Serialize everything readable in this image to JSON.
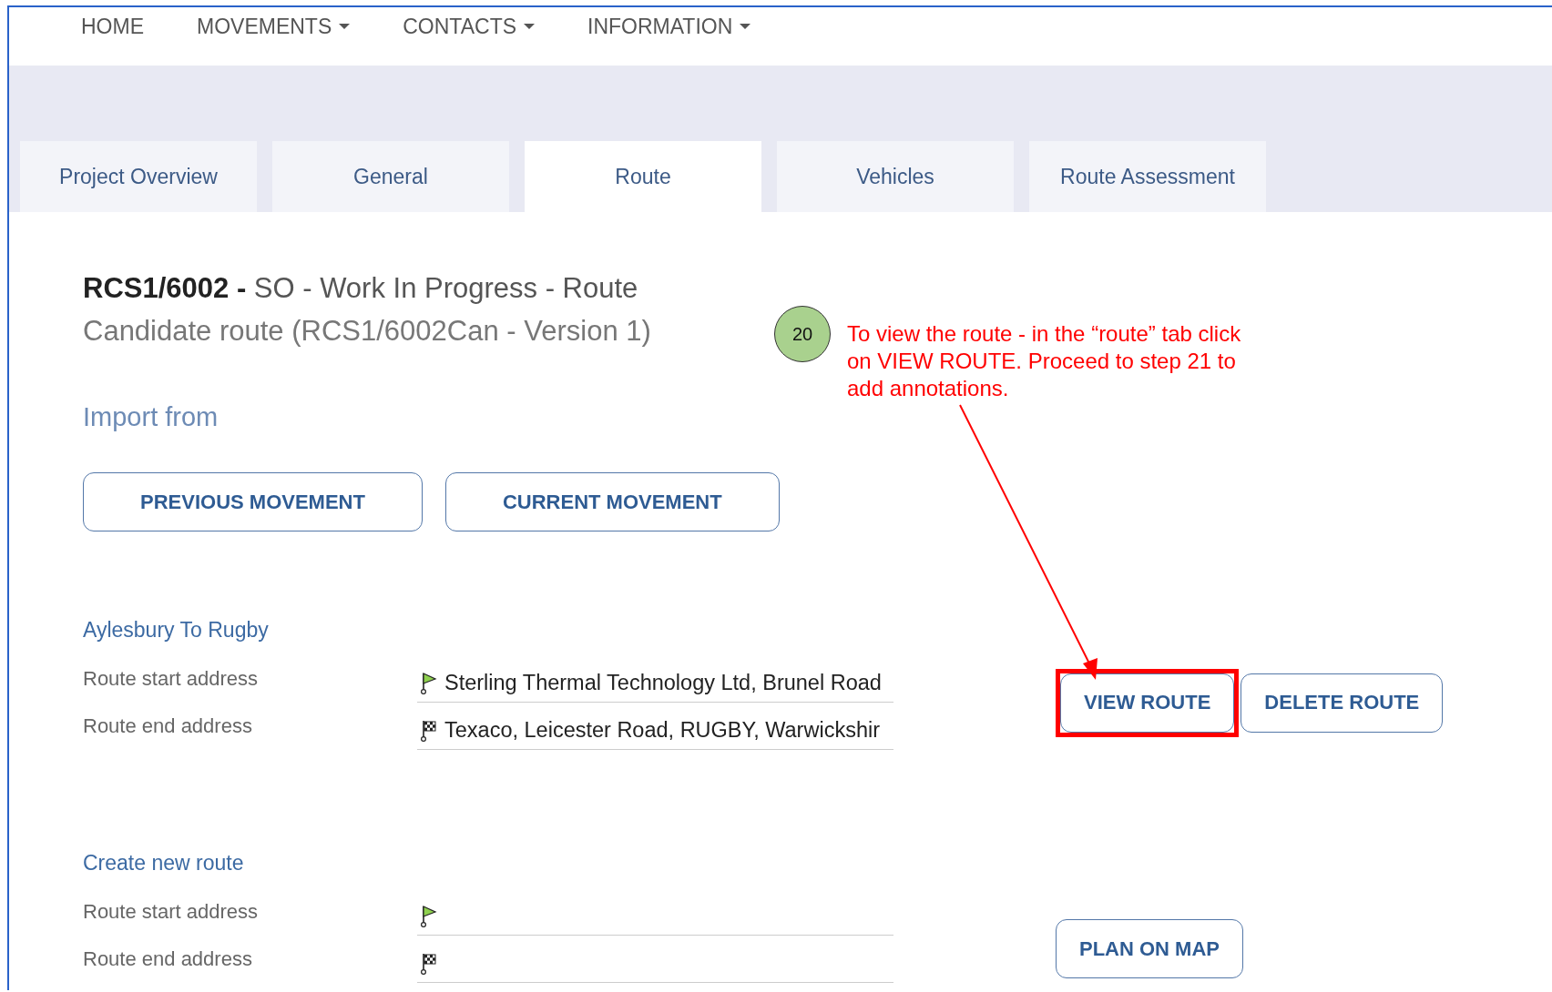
{
  "nav": [
    {
      "label": "HOME",
      "dropdown": false
    },
    {
      "label": "MOVEMENTS",
      "dropdown": true
    },
    {
      "label": "CONTACTS",
      "dropdown": true
    },
    {
      "label": "INFORMATION",
      "dropdown": true
    }
  ],
  "tabs": [
    {
      "label": "Project Overview",
      "selected": false
    },
    {
      "label": "General",
      "selected": false
    },
    {
      "label": "Route",
      "selected": true
    },
    {
      "label": "Vehicles",
      "selected": false
    },
    {
      "label": "Route Assessment",
      "selected": false
    }
  ],
  "title": {
    "heading": "**RCS1/6002 -** SO - Work In Progress - Route",
    "subtitle": "Candidate route (RCS1/6002Can - Version 1)"
  },
  "import": {
    "heading": "Import from",
    "buttons": [
      "PREVIOUS MOVEMENT",
      "CURRENT MOVEMENT"
    ]
  },
  "annotation": {
    "step": "20",
    "text": "To view the route - in the “route” tab click on VIEW ROUTE.  Proceed to step 21 to add annotations."
  },
  "sections": [
    {
      "title": "Aylesbury To Rugby",
      "fields": [
        {
          "label": "Route start address",
          "kind": "start",
          "value": "Sterling Thermal Technology Ltd, Brunel Road"
        },
        {
          "label": "Route end address",
          "kind": "end",
          "value": "Texaco, Leicester Road, RUGBY, Warwickshir"
        }
      ],
      "buttons": [
        {
          "label": "VIEW ROUTE",
          "highlighted": true
        },
        {
          "label": "DELETE ROUTE",
          "highlighted": false
        }
      ]
    },
    {
      "title": "Create new route",
      "fields": [
        {
          "label": "Route start address",
          "kind": "start"
        },
        {
          "label": "Route end address",
          "kind": "end"
        }
      ],
      "buttons": [
        {
          "label": "PLAN ON MAP",
          "highlighted": false
        }
      ]
    }
  ]
}
